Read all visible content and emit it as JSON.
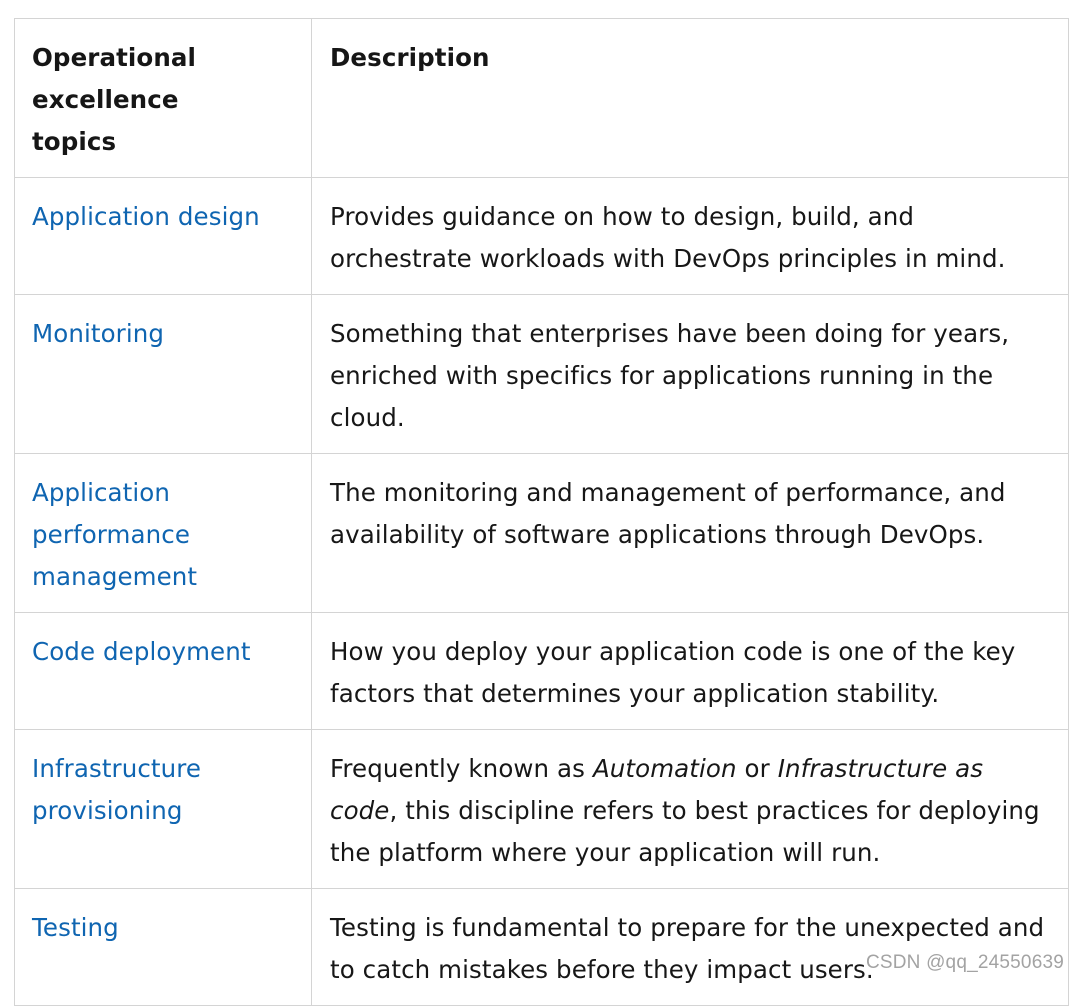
{
  "table": {
    "headers": {
      "topic": "Operational excellence topics",
      "description": "Description"
    },
    "rows": [
      {
        "topic": "Application design",
        "description": [
          {
            "text": "Provides guidance on how to design, build, and orchestrate workloads with DevOps principles in mind.",
            "italic": false
          }
        ]
      },
      {
        "topic": "Monitoring",
        "description": [
          {
            "text": "Something that enterprises have been doing for years, enriched with specifics for applications running in the cloud.",
            "italic": false
          }
        ]
      },
      {
        "topic": "Application performance management",
        "description": [
          {
            "text": "The monitoring and management of performance, and availability of software applications through DevOps.",
            "italic": false
          }
        ]
      },
      {
        "topic": "Code deployment",
        "description": [
          {
            "text": "How you deploy your application code is one of the key factors that determines your application stability.",
            "italic": false
          }
        ]
      },
      {
        "topic": "Infrastructure provisioning",
        "description": [
          {
            "text": "Frequently known as ",
            "italic": false
          },
          {
            "text": "Automation",
            "italic": true
          },
          {
            "text": " or ",
            "italic": false
          },
          {
            "text": "Infrastructure as code",
            "italic": true
          },
          {
            "text": ", this discipline refers to best practices for deploying the platform where your application will run.",
            "italic": false
          }
        ]
      },
      {
        "topic": "Testing",
        "description": [
          {
            "text": "Testing is fundamental to prepare for the unexpected and to catch mistakes before they impact users.",
            "italic": false
          }
        ]
      }
    ]
  },
  "watermark": "CSDN @qq_24550639",
  "colors": {
    "link": "#0f65b1",
    "text": "#171717",
    "border": "#d4d4d4",
    "watermark": "#a3a3a3"
  }
}
